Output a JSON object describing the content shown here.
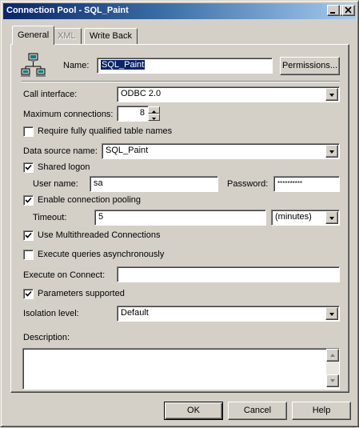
{
  "window": {
    "title": "Connection Pool - SQL_Paint"
  },
  "tabs": [
    {
      "label": "General"
    },
    {
      "label": "XML"
    },
    {
      "label": "Write Back"
    }
  ],
  "general": {
    "name_label": "Name:",
    "name_value": "SQL_Paint",
    "permissions_label": "Permissions...",
    "call_interface_label": "Call interface:",
    "call_interface_value": "ODBC 2.0",
    "max_connections_label": "Maximum connections:",
    "max_connections_value": "8",
    "require_qualified_label": "Require fully qualified table names",
    "require_qualified_checked": false,
    "dsn_label": "Data source name:",
    "dsn_value": "SQL_Paint",
    "shared_logon_label": "Shared logon",
    "shared_logon_checked": true,
    "user_name_label": "User name:",
    "user_name_value": "sa",
    "password_label": "Password:",
    "password_value": "**********",
    "pooling_label": "Enable connection pooling",
    "pooling_checked": true,
    "timeout_label": "Timeout:",
    "timeout_value": "5",
    "timeout_unit": "(minutes)",
    "multithreaded_label": "Use Multithreaded Connections",
    "multithreaded_checked": true,
    "async_label": "Execute queries asynchronously",
    "async_checked": false,
    "execute_on_connect_label": "Execute on Connect:",
    "execute_on_connect_value": "",
    "params_supported_label": "Parameters supported",
    "params_supported_checked": true,
    "isolation_label": "Isolation level:",
    "isolation_value": "Default",
    "description_label": "Description:",
    "description_value": ""
  },
  "footer": {
    "ok": "OK",
    "cancel": "Cancel",
    "help": "Help"
  },
  "icons": {
    "connection_pool": "network-computers-icon"
  }
}
